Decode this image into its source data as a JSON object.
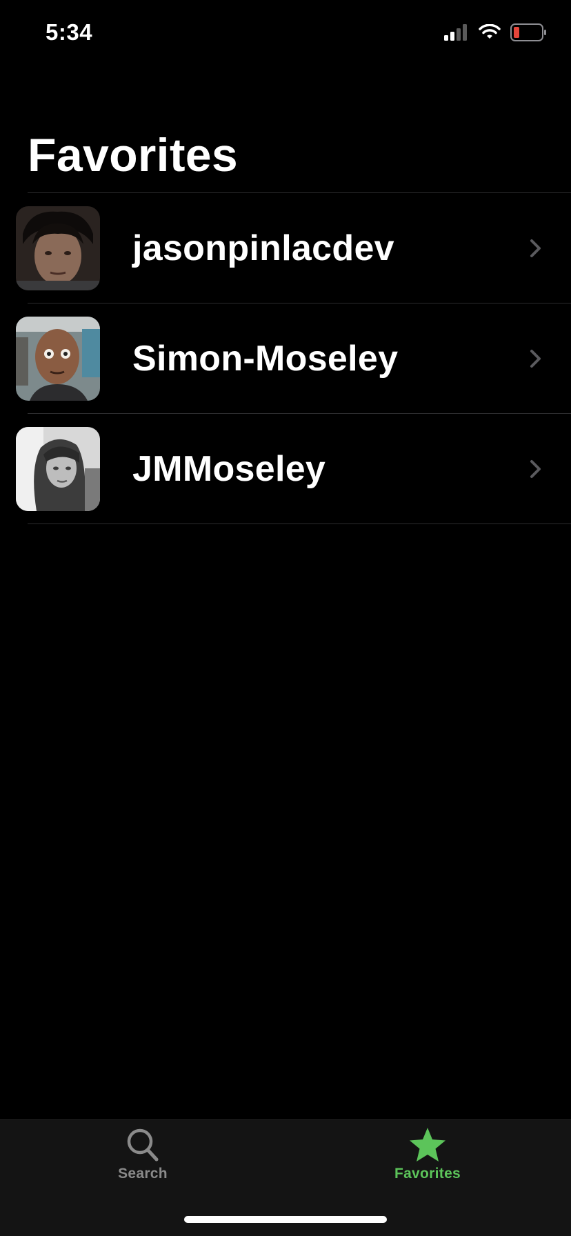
{
  "status_bar": {
    "time": "5:34"
  },
  "header": {
    "title": "Favorites"
  },
  "favorites": [
    {
      "name": "jasonpinlacdev"
    },
    {
      "name": "Simon-Moseley"
    },
    {
      "name": "JMMoseley"
    }
  ],
  "tab_bar": {
    "tabs": [
      {
        "label": "Search",
        "icon": "search-icon",
        "active": false
      },
      {
        "label": "Favorites",
        "icon": "star-icon",
        "active": true
      }
    ]
  },
  "colors": {
    "background": "#000000",
    "accent": "#5cc45a",
    "inactive_tab": "#8a8a8a",
    "battery_low": "#e5453a",
    "separator": "#2c2c2e"
  }
}
